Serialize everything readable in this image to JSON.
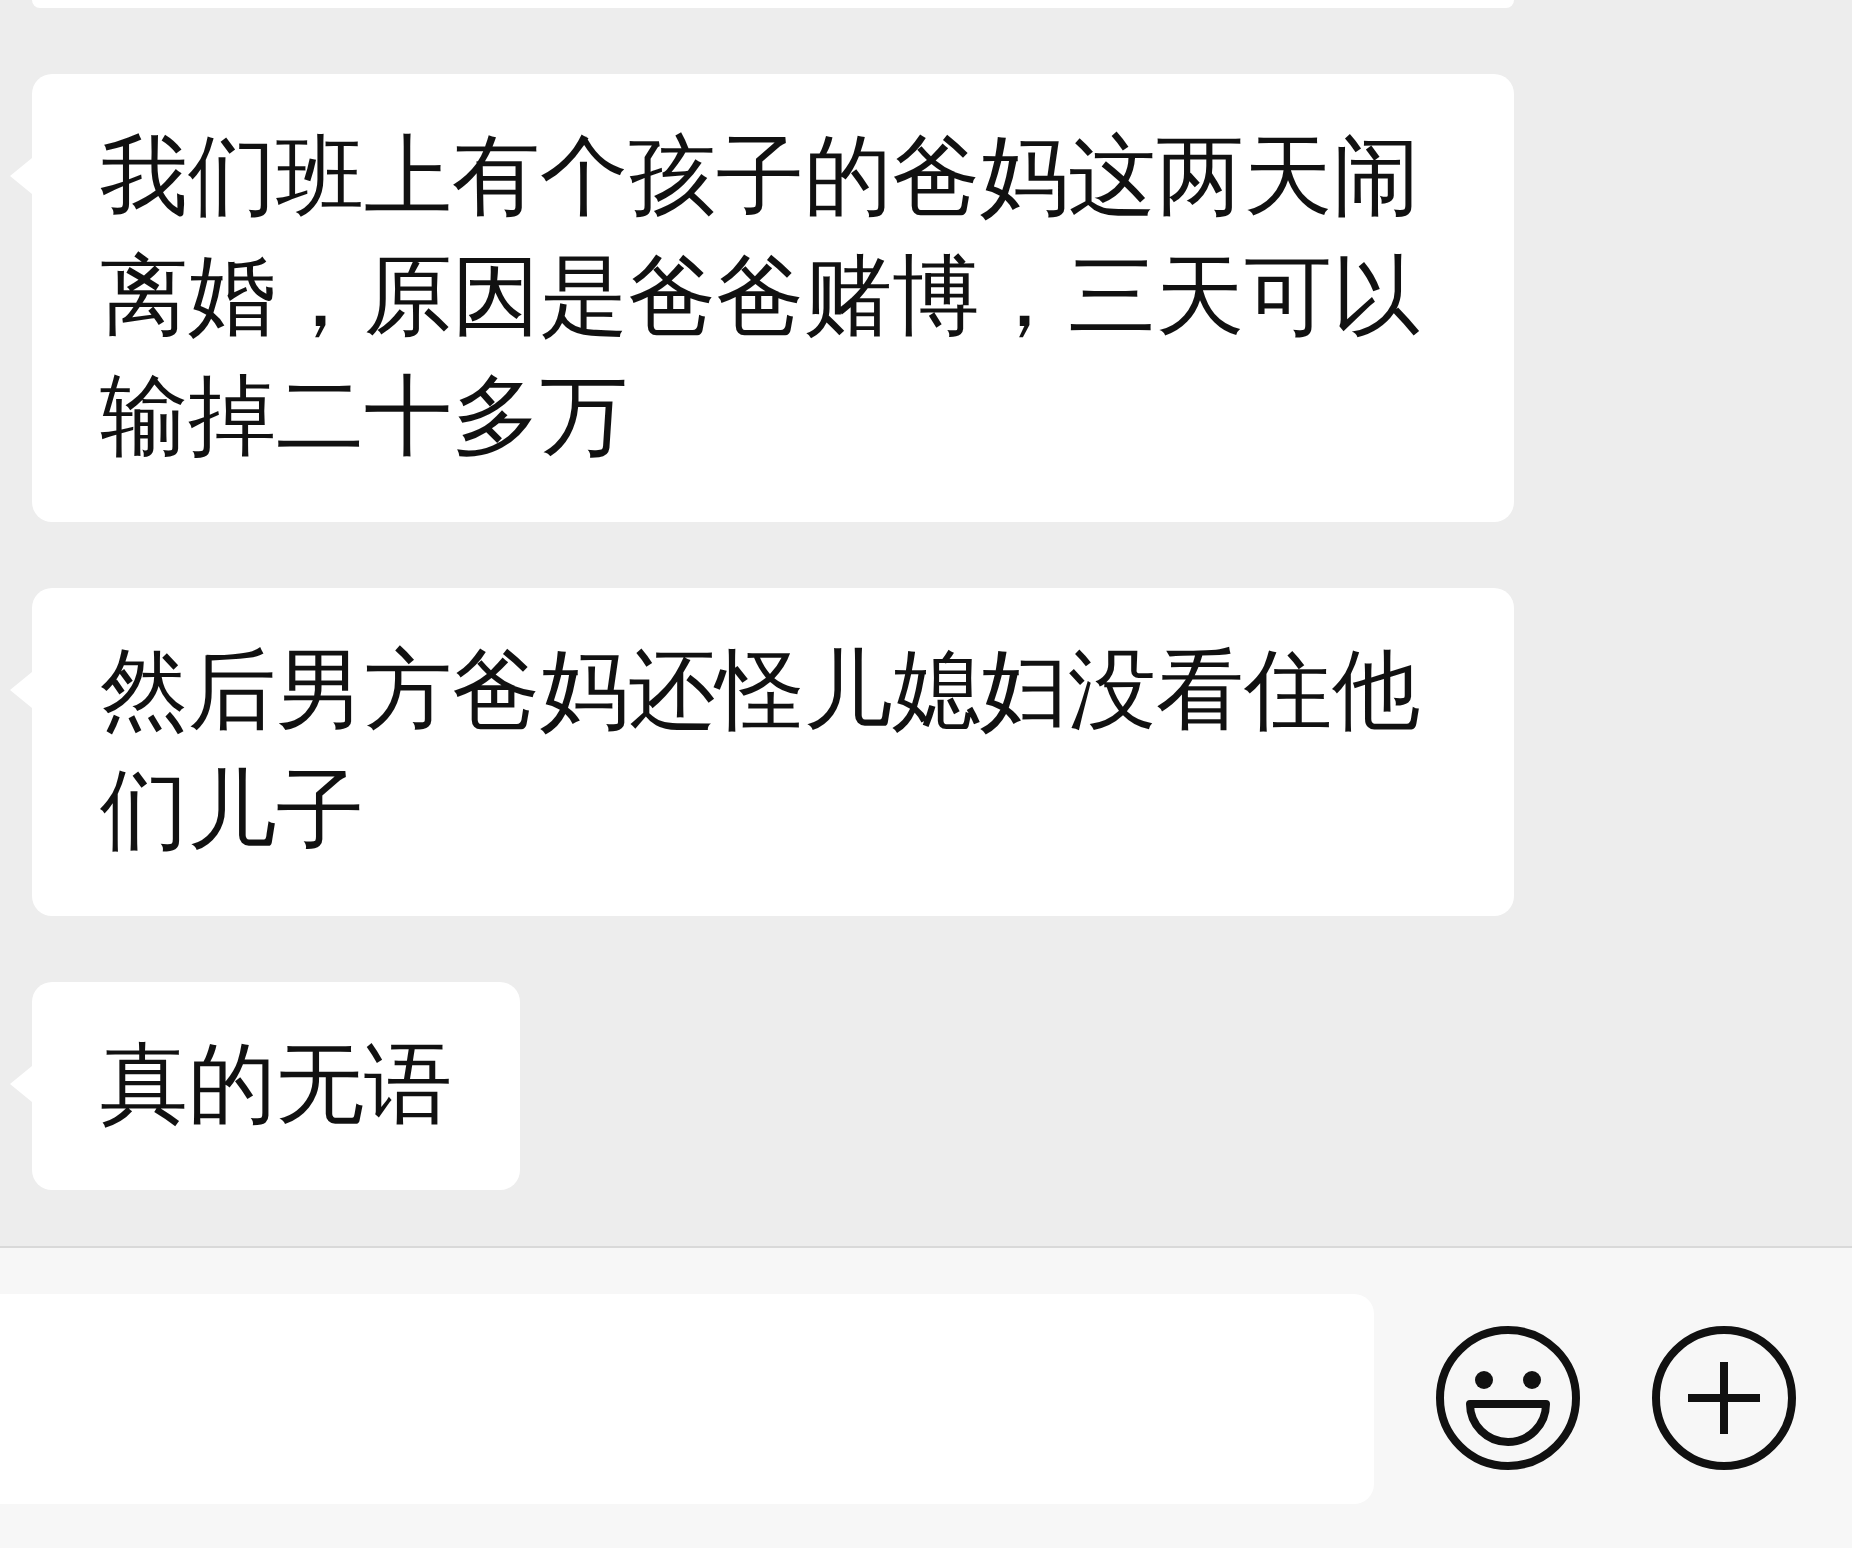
{
  "messages": [
    {
      "text": "我们班上有个孩子的爸妈这两天闹离婚，原因是爸爸赌博，三天可以输掉二十多万"
    },
    {
      "text": "然后男方爸妈还怪儿媳妇没看住他们儿子"
    },
    {
      "text": "真的无语"
    }
  ]
}
